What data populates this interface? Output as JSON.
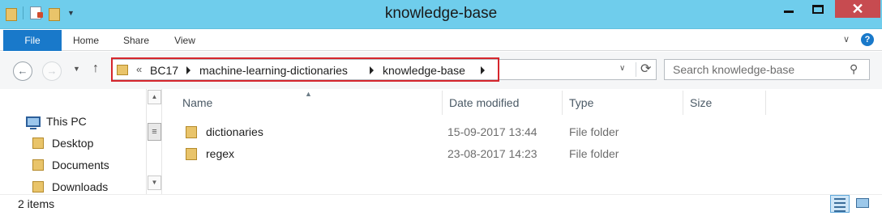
{
  "window": {
    "title": "knowledge-base",
    "close_glyph": "✕"
  },
  "ribbon": {
    "tabs": [
      {
        "label": "File"
      },
      {
        "label": "Home"
      },
      {
        "label": "Share"
      },
      {
        "label": "View"
      }
    ],
    "accent_color": "#1979ca",
    "help_glyph": "?"
  },
  "navigation": {
    "back_glyph": "←",
    "forward_glyph": "→",
    "up_glyph": "↑",
    "address": {
      "overflow_glyph": "«",
      "breadcrumbs": [
        "BC17",
        "machine-learning-dictionaries",
        "knowledge-base"
      ],
      "highlight_color": "#d6262d"
    },
    "search": {
      "placeholder": "Search knowledge-base"
    }
  },
  "nav_pane": {
    "items": [
      {
        "label": "This PC",
        "icon": "computer-icon"
      },
      {
        "label": "Desktop",
        "icon": "folder-icon"
      },
      {
        "label": "Documents",
        "icon": "folder-icon"
      },
      {
        "label": "Downloads",
        "icon": "folder-icon"
      }
    ]
  },
  "file_list": {
    "columns": [
      "Name",
      "Date modified",
      "Type",
      "Size"
    ],
    "rows": [
      {
        "name": "dictionaries",
        "date_modified": "15-09-2017 13:44",
        "type": "File folder",
        "size": ""
      },
      {
        "name": "regex",
        "date_modified": "23-08-2017 14:23",
        "type": "File folder",
        "size": ""
      }
    ]
  },
  "status": {
    "item_count": "2 items"
  },
  "colors": {
    "titlebar": "#6fcdec",
    "close_button": "#c74b50",
    "folder": "#e9c46a"
  }
}
